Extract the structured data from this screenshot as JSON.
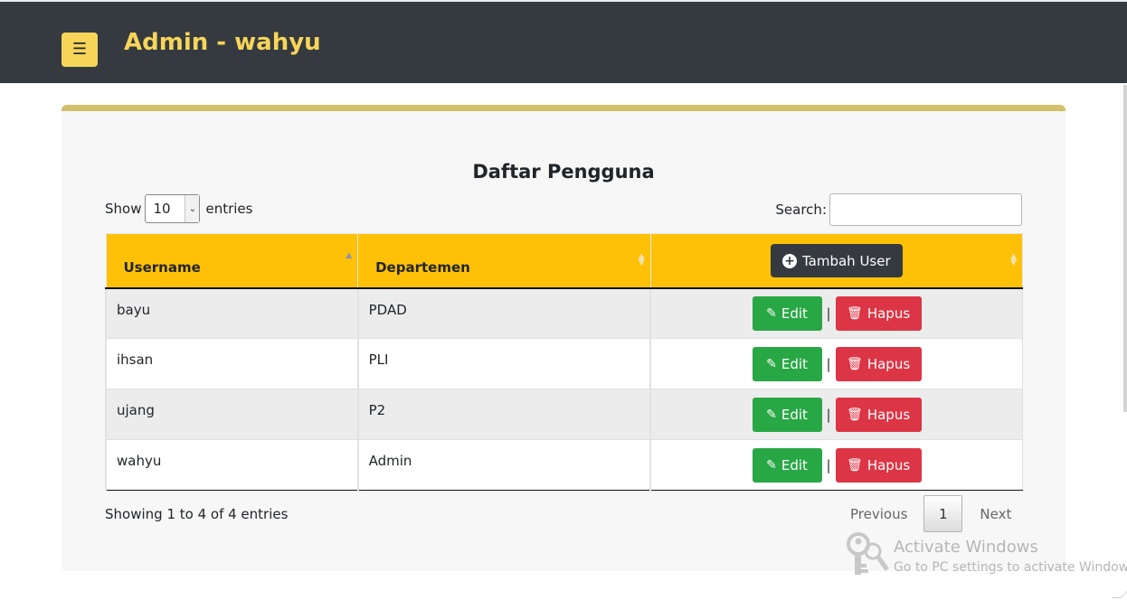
{
  "header": {
    "menu_icon": "hamburger-icon",
    "title": "Admin - wahyu",
    "accent_color": "#f7d559",
    "bg_color": "#343a40"
  },
  "card": {
    "title": "Daftar Pengguna",
    "border_color": "#d4bf6b"
  },
  "length": {
    "prefix": "Show",
    "value": "10",
    "suffix": "entries"
  },
  "search": {
    "label": "Search:",
    "value": ""
  },
  "table": {
    "header_color": "#ffc107",
    "columns": [
      "Username",
      "Departemen"
    ],
    "add_button_label": "Tambah User",
    "rows": [
      {
        "username": "bayu",
        "departemen": "PDAD"
      },
      {
        "username": "ihsan",
        "departemen": "PLI"
      },
      {
        "username": "ujang",
        "departemen": "P2"
      },
      {
        "username": "wahyu",
        "departemen": "Admin"
      }
    ],
    "edit_label": "Edit",
    "delete_label": "Hapus",
    "separator": "|",
    "edit_color": "#28a745",
    "delete_color": "#dc3545"
  },
  "footer": {
    "info": "Showing 1 to 4 of 4 entries",
    "previous": "Previous",
    "current_page": "1",
    "next": "Next"
  },
  "watermark": {
    "title": "Activate Windows",
    "subtitle": "Go to PC settings to activate Windows."
  }
}
